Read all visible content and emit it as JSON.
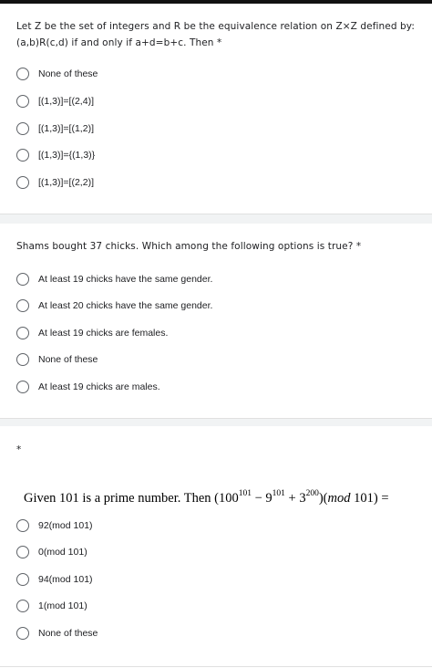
{
  "questions": [
    {
      "text": "Let Z be the set of integers and R be the equivalence relation on Z×Z defined by: (a,b)R(c,d) if and only if a+d=b+c. Then",
      "required": "*",
      "options": [
        "None of these",
        "[(1,3)]=[(2,4)]",
        "[(1,3)]=[(1,2)]",
        "[(1,3)]={(1,3)}",
        "[(1,3)]=[(2,2)]"
      ]
    },
    {
      "text": "Shams bought 37 chicks. Which among the following options is true?",
      "required": "*",
      "options": [
        "At least 19 chicks have the same gender.",
        "At least 20 chicks have the same gender.",
        "At least 19 chicks are females.",
        "None of these",
        "At least 19 chicks are males."
      ]
    },
    {
      "required": "*",
      "math": {
        "prefix": "Given 101 is a prime number. Then (100",
        "exp1": "101",
        "mid1": " − 9",
        "exp2": "101",
        "mid2": " + 3",
        "exp3": "200",
        "mid3": ")(",
        "mod_word": "mod",
        "suffix": " 101) ="
      },
      "options": [
        "92(mod 101)",
        "0(mod 101)",
        "94(mod 101)",
        "1(mod 101)",
        "None of these"
      ]
    }
  ]
}
